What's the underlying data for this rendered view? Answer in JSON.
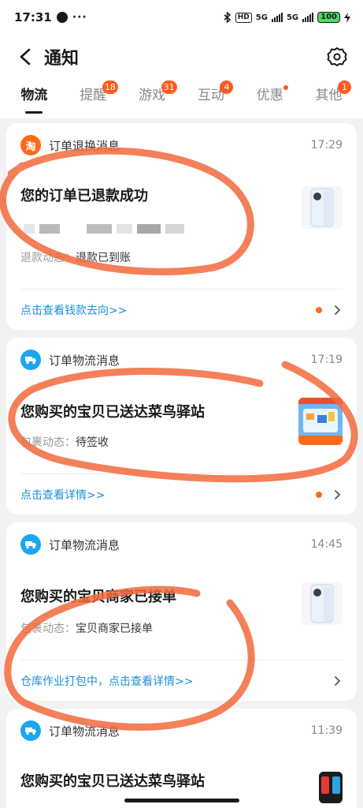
{
  "status_bar": {
    "time": "17:31",
    "more": "···",
    "network_1": "5G",
    "network_2": "5G",
    "battery": "100"
  },
  "header": {
    "title": "通知"
  },
  "tabs": [
    {
      "label": "物流",
      "badge": ""
    },
    {
      "label": "提醒",
      "badge": "18"
    },
    {
      "label": "游戏",
      "badge": "31"
    },
    {
      "label": "互动",
      "badge": "4"
    },
    {
      "label": "优惠",
      "badge": ""
    },
    {
      "label": "其他",
      "badge": "1"
    }
  ],
  "cards": [
    {
      "icon_glyph": "淘",
      "category": "订单退换消息",
      "time": "17:29",
      "title": "您的订单已退款成功",
      "line_label": "退款动态：",
      "line_value": "退款已到账",
      "footer": "点击查看钱款去向>>"
    },
    {
      "category": "订单物流消息",
      "time": "17:19",
      "title": "您购买的宝贝已送达菜鸟驿站",
      "line_label": "包裹动态：",
      "line_value": "待签收",
      "footer": "点击查看详情>>"
    },
    {
      "category": "订单物流消息",
      "time": "14:45",
      "title": "您购买的宝贝商家已接单",
      "line_label": "包裹动态：",
      "line_value": "宝贝商家已接单",
      "footer": "仓库作业打包中，点击查看详情>>"
    },
    {
      "category": "订单物流消息",
      "time": "11:39",
      "title": "您购买的宝贝已送达菜鸟驿站"
    }
  ],
  "colors": {
    "accent_orange": "#ff6a1a",
    "link_blue": "#1a8fd8",
    "truck_blue": "#1aa7ee",
    "annotation": "#f26a3c"
  }
}
